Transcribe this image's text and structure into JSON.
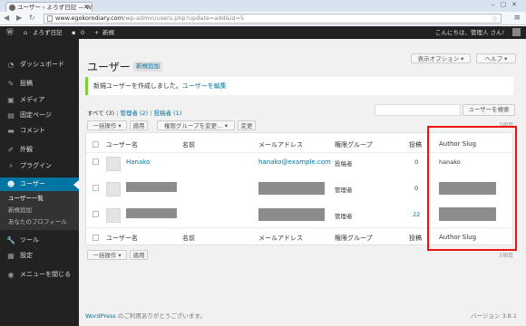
{
  "browser": {
    "tab_title": "ユーザー ‹ よろず日記 — W",
    "url_host": "www.egokorodiary.com",
    "url_path": "/wp-admin/users.php?update=add&id=5"
  },
  "adminbar": {
    "site_name": "よろず日記",
    "comments_count": "0",
    "new_label": "新規",
    "greeting": "こんにちは、管理人 さん!"
  },
  "sidebar": {
    "items": [
      {
        "icon": "dashboard-icon",
        "label": "ダッシュボード"
      },
      {
        "icon": "pin-icon",
        "label": "投稿"
      },
      {
        "icon": "media-icon",
        "label": "メディア"
      },
      {
        "icon": "page-icon",
        "label": "固定ページ"
      },
      {
        "icon": "comment-icon",
        "label": "コメント"
      },
      {
        "icon": "brush-icon",
        "label": "外観"
      },
      {
        "icon": "plugin-icon",
        "label": "プラグイン"
      },
      {
        "icon": "users-icon",
        "label": "ユーザー"
      },
      {
        "icon": "wrench-icon",
        "label": "ツール"
      },
      {
        "icon": "settings-icon",
        "label": "設定"
      },
      {
        "icon": "collapse-icon",
        "label": "メニューを閉じる"
      }
    ],
    "sub_items": [
      "ユーザー一覧",
      "新規追加",
      "あなたのプロフィール"
    ]
  },
  "header": {
    "screen_options": "表示オプション ▾",
    "help": "ヘルプ ▾",
    "title": "ユーザー",
    "add_new": "新規追加"
  },
  "notice": {
    "text": "新規ユーザーを作成しました。",
    "link": "ユーザーを編集"
  },
  "filters": {
    "all": "すべて (3)",
    "admin": "管理者 (2)",
    "author": "投稿者 (1)",
    "sep": "|"
  },
  "search_button": "ユーザーを検索",
  "item_count": "3項目",
  "bulk": {
    "action": "一括操作 ▾",
    "apply": "適用",
    "role_change": "権限グループを変更… ▾",
    "change": "変更"
  },
  "table": {
    "headers": [
      "ユーザー名",
      "名前",
      "メールアドレス",
      "権限グループ",
      "投稿",
      "Author Slug"
    ],
    "rows": [
      {
        "username": "Hanako",
        "email": "hanako@example.com",
        "role": "投稿者",
        "posts": "0",
        "slug": "hanako"
      },
      {
        "username": "",
        "email": "",
        "role": "管理者",
        "posts": "0",
        "slug": ""
      },
      {
        "username": "",
        "email": "",
        "role": "管理者",
        "posts": "22",
        "slug": ""
      }
    ]
  },
  "footer": {
    "thanks_link": "WordPress",
    "thanks_text": " のご利用ありがとうございます。",
    "version": "バージョン 3.8.1"
  },
  "colors": {
    "accent": "#0074a2",
    "adminbar": "#222222",
    "highlight": "#e11111",
    "notice": "#7ad03a"
  }
}
